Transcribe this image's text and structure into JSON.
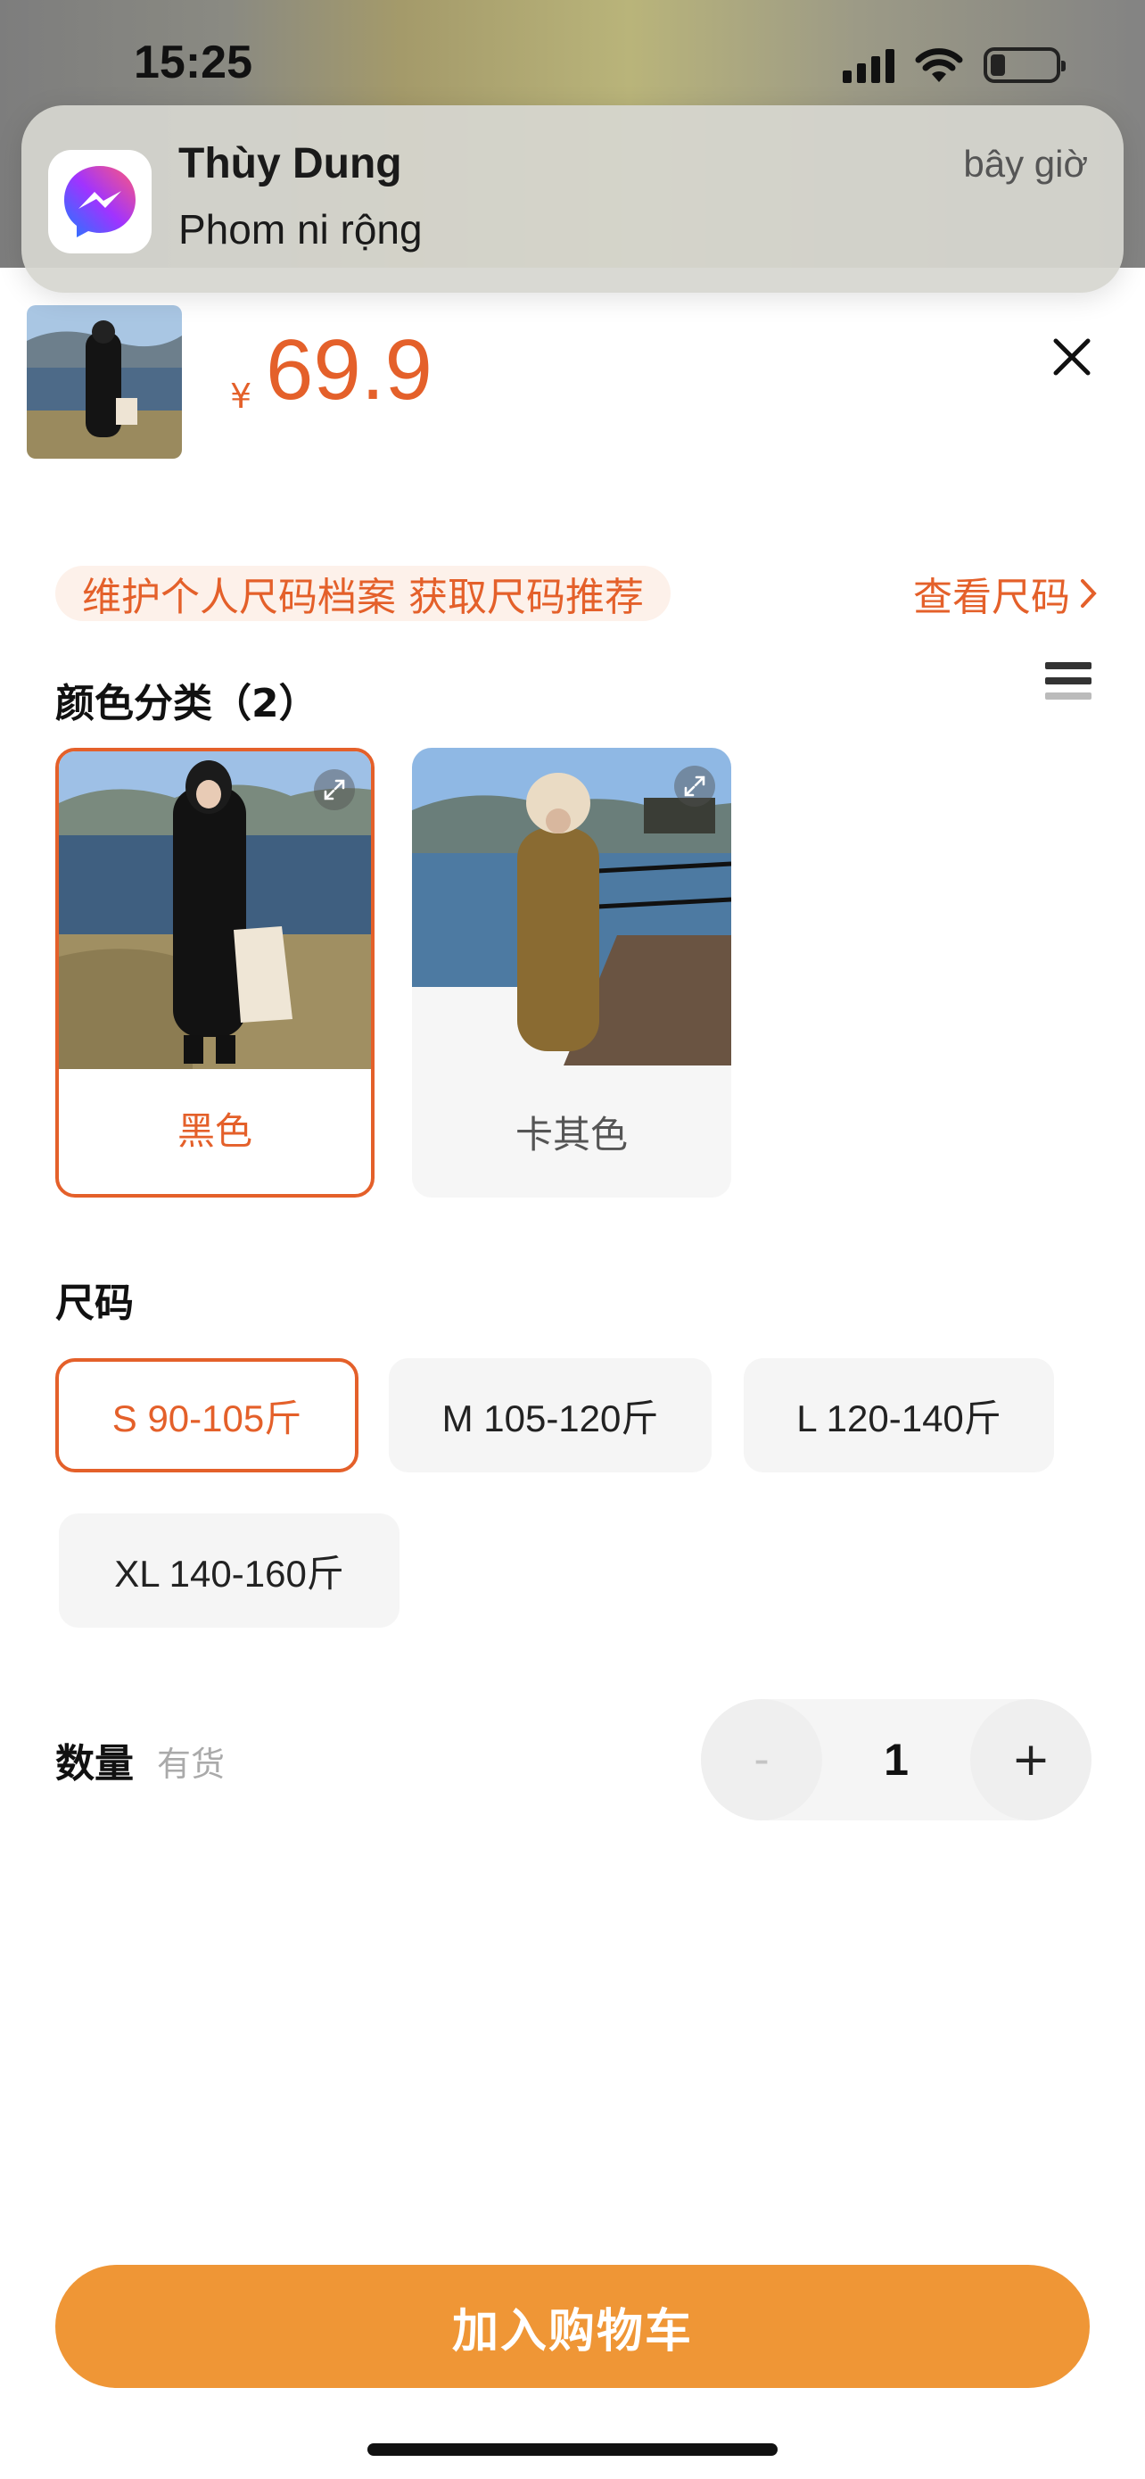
{
  "status_bar": {
    "time": "15:25"
  },
  "notification": {
    "app_icon": "messenger-icon",
    "sender": "Thùy Dung",
    "message": "Phom ni rộng",
    "time": "bây giờ"
  },
  "product": {
    "currency_symbol": "¥",
    "price": "69.9"
  },
  "size_profile": {
    "prompt": "维护个人尺码档案 获取尺码推荐",
    "view_link": "查看尺码"
  },
  "color_section": {
    "title": "颜色分类（2）",
    "options": [
      {
        "label": "黑色",
        "selected": true
      },
      {
        "label": "卡其色",
        "selected": false
      }
    ]
  },
  "size_section": {
    "title": "尺码",
    "options": [
      {
        "label": "S 90-105斤",
        "selected": true
      },
      {
        "label": "M 105-120斤",
        "selected": false
      },
      {
        "label": "L 120-140斤",
        "selected": false
      },
      {
        "label": "XL 140-160斤",
        "selected": false
      }
    ]
  },
  "quantity": {
    "title": "数量",
    "stock": "有货",
    "minus": "-",
    "value": "1",
    "plus": "+"
  },
  "cart_button": {
    "label": "加入购物车"
  },
  "colors": {
    "accent": "#e4602a",
    "cart_button": "#ef9636"
  }
}
